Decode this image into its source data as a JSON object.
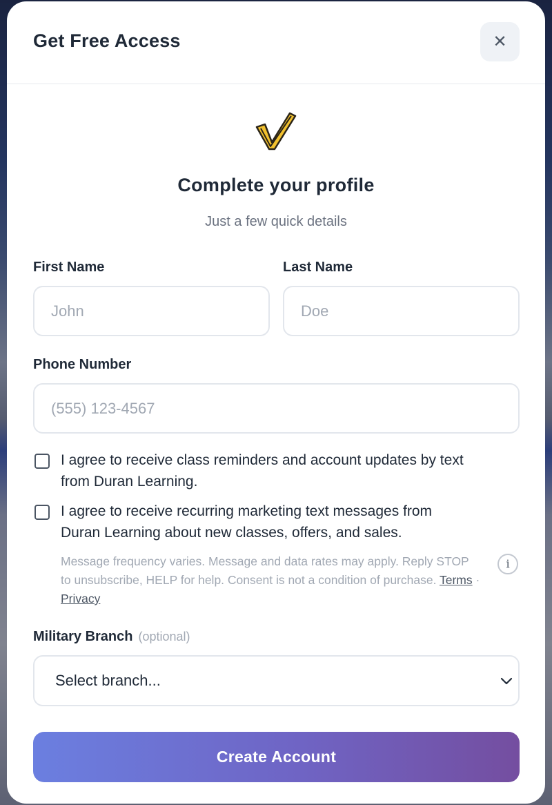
{
  "header": {
    "title": "Get Free Access",
    "close_symbol": "✕"
  },
  "hero": {
    "logo_icon": "checkmark-logo-icon",
    "title": "Complete your profile",
    "subtitle": "Just a few quick details"
  },
  "form": {
    "first_name": {
      "label": "First Name",
      "placeholder": "John",
      "value": ""
    },
    "last_name": {
      "label": "Last Name",
      "placeholder": "Doe",
      "value": ""
    },
    "phone": {
      "label": "Phone Number",
      "placeholder": "(555) 123-4567",
      "value": ""
    },
    "consent_reminders": {
      "line1": "I agree to receive class reminders and account updates by text",
      "line2": "from Duran Learning.",
      "checked": false
    },
    "consent_marketing": {
      "line1": "I agree to receive recurring marketing text messages from",
      "line2": "Duran Learning about new classes, offers, and sales.",
      "checked": false
    },
    "disclaimer": {
      "text": "Message frequency varies. Message and data rates may apply. Reply STOP to unsubscribe, HELP for help. Consent is not a condition of purchase.",
      "terms_label": "Terms",
      "separator": "·",
      "privacy_label": "Privacy",
      "info_symbol": "i"
    },
    "military_branch": {
      "label": "Military Branch",
      "optional_label": "(optional)",
      "selected": "Select branch..."
    },
    "submit_label": "Create Account"
  },
  "colors": {
    "brand_gold": "#f2c12e",
    "cta_start": "#6b7fe0",
    "cta_end": "#744ea0"
  }
}
